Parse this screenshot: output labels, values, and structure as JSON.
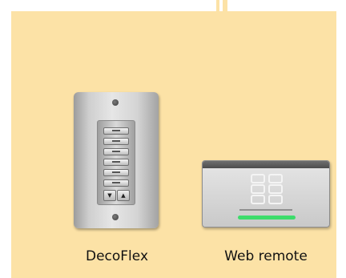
{
  "labels": {
    "decoflex": "DecoFlex",
    "web_remote": "Web remote"
  },
  "keypad": {
    "arrow_down": "▼",
    "arrow_up": "▲"
  }
}
